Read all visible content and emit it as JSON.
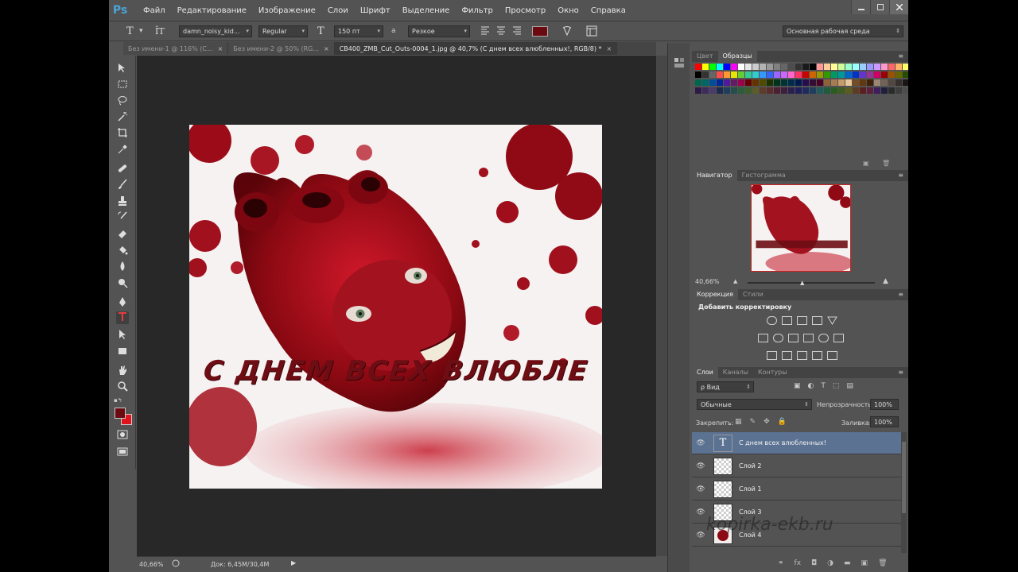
{
  "app": {
    "logo": "Ps",
    "menu": [
      "Файл",
      "Редактирование",
      "Изображение",
      "Слои",
      "Шрифт",
      "Выделение",
      "Фильтр",
      "Просмотр",
      "Окно",
      "Справка"
    ]
  },
  "options_bar": {
    "tool_glyph": "T",
    "orient_glyph": "ÎT",
    "font_family": "damn_noisy_kid...",
    "font_style": "Regular",
    "size_glyph": "T",
    "font_size": "150 пт",
    "aa_glyph": "a",
    "antialias": "Резкое",
    "text_color": "#6b0a10",
    "workspace": "Основная рабочая среда"
  },
  "tabs": [
    {
      "label": "Без имени-1 @ 116% (С...",
      "active": false
    },
    {
      "label": "Без имени-2 @ 50% (RG...",
      "active": false
    },
    {
      "label": "CB400_ZMB_Cut_Outs-0004_1.jpg @ 40,7% (С днем  всех влюбленных!, RGB/8) *",
      "active": true
    }
  ],
  "canvas": {
    "overlay_text": "С ДНЕМ  ВСЕХ ВЛЮБЛЕ"
  },
  "colors": {
    "foreground": "#6b0a10",
    "background": "#e0121c"
  },
  "status": {
    "zoom": "40,66%",
    "doc": "Док: 6,45M/30,4M"
  },
  "panels": {
    "swatches_tabs": [
      "Цвет",
      "Образцы"
    ],
    "navigator_tabs": [
      "Навигатор",
      "Гистограмма"
    ],
    "navigator_zoom": "40,66%",
    "adjust_tabs": [
      "Коррекция",
      "Стили"
    ],
    "adjust_title": "Добавить корректировку",
    "layers_tabs": [
      "Слои",
      "Каналы",
      "Контуры"
    ],
    "layer_filter": "ρ Вид",
    "blend_mode": "Обычные",
    "opacity_label": "Непрозрачность:",
    "opacity_value": "100%",
    "lock_label": "Закрепить:",
    "fill_label": "Заливка:",
    "fill_value": "100%",
    "layers": [
      {
        "name": "С днем  всех влюбленных!",
        "type": "text",
        "selected": true
      },
      {
        "name": "Слой 2",
        "type": "pixel",
        "selected": false
      },
      {
        "name": "Слой 1",
        "type": "pixel",
        "selected": false
      },
      {
        "name": "Слой 3",
        "type": "pixel",
        "selected": false
      },
      {
        "name": "Слой 4",
        "type": "image",
        "selected": false
      }
    ]
  },
  "watermark": "kopirka-ekb.ru"
}
